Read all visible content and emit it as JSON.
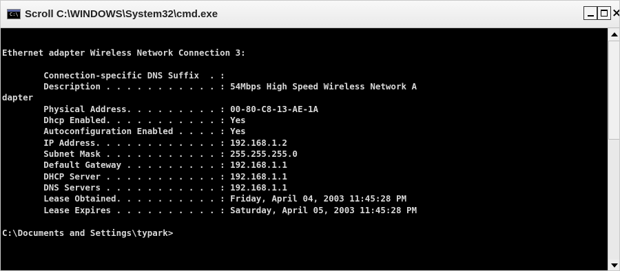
{
  "window": {
    "title": "Scroll C:\\WINDOWS\\System32\\cmd.exe",
    "app_icon_text": "C:\\",
    "buttons": {
      "minimize": "minimize",
      "maximize": "maximize",
      "close": "close"
    }
  },
  "console": {
    "lines": [
      "Ethernet adapter Wireless Network Connection 3:",
      "",
      "        Connection-specific DNS Suffix  . :",
      "        Description . . . . . . . . . . . : 54Mbps High Speed Wireless Network A",
      "dapter",
      "        Physical Address. . . . . . . . . : 00-80-C8-13-AE-1A",
      "        Dhcp Enabled. . . . . . . . . . . : Yes",
      "        Autoconfiguration Enabled . . . . : Yes",
      "        IP Address. . . . . . . . . . . . : 192.168.1.2",
      "        Subnet Mask . . . . . . . . . . . : 255.255.255.0",
      "        Default Gateway . . . . . . . . . : 192.168.1.1",
      "        DHCP Server . . . . . . . . . . . : 192.168.1.1",
      "        DNS Servers . . . . . . . . . . . : 192.168.1.1",
      "        Lease Obtained. . . . . . . . . . : Friday, April 04, 2003 11:45:28 PM",
      "        Lease Expires . . . . . . . . . . : Saturday, April 05, 2003 11:45:28 PM",
      "",
      "C:\\Documents and Settings\\typark>"
    ]
  }
}
